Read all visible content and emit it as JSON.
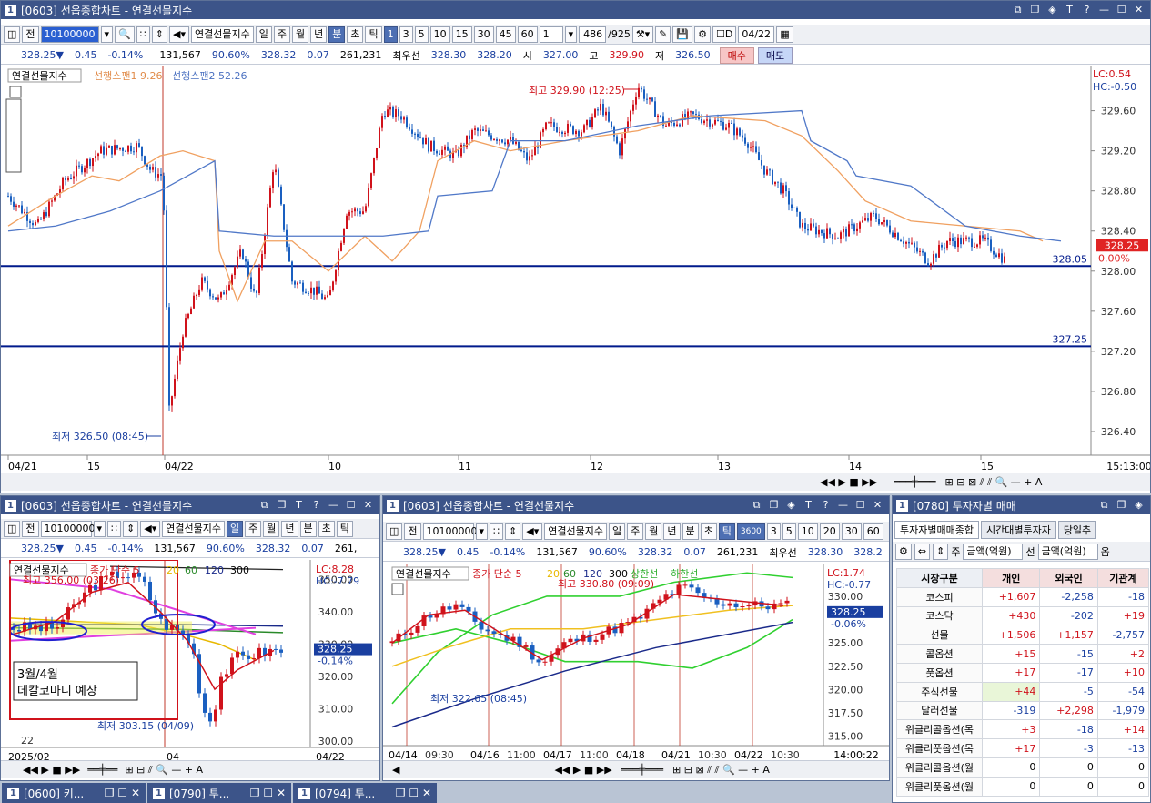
{
  "main": {
    "title": "[0603] 선옵종합차트 - 연결선물지수",
    "toolbar": {
      "code": "10100000",
      "name": "연결선물지수",
      "periods": [
        "일",
        "주",
        "월",
        "년",
        "분",
        "초",
        "틱"
      ],
      "intervals": [
        "1",
        "3",
        "5",
        "10",
        "15",
        "30",
        "45",
        "60"
      ],
      "unit": "1",
      "count": "486",
      "total": "/925",
      "date": "04/22",
      "jeon": "전"
    },
    "price": {
      "current": "328.25▼",
      "change": "0.45",
      "rate": "-0.14%",
      "volume": "131,567",
      "ratio": "90.60%",
      "avg": "328.32",
      "diff": "0.07",
      "oi": "261,231",
      "best_label": "최우선",
      "bid": "328.30",
      "ask": "328.20",
      "open_label": "시",
      "open": "327.00",
      "high_label": "고",
      "high": "329.90",
      "low_label": "저",
      "low": "326.50",
      "buy": "매수",
      "sell": "매도"
    },
    "legend": {
      "series1": "연결선물지수",
      "series2": "선행스팬1 9.26",
      "series3": "선행스팬2 52.26"
    },
    "lc": "LC:0.54",
    "hc": "HC:-0.50",
    "annot_high": "최고 329.90 (12:25)",
    "annot_low": "최저 326.50 (08:45)",
    "hline1": "328.05",
    "hline2": "327.25",
    "last_price": "328.25",
    "last_rate": "0.00%",
    "y_ticks": [
      "329.60",
      "329.20",
      "328.80",
      "328.40",
      "328.00",
      "327.60",
      "327.20",
      "326.80",
      "326.40"
    ],
    "x_ticks": [
      "04/21",
      "15",
      "04/22",
      "10",
      "11",
      "12",
      "13",
      "14",
      "15",
      "15:13:00"
    ]
  },
  "left": {
    "title": "[0603] 선옵종합차트 - 연결선물지수",
    "toolbar": {
      "code": "10100000",
      "name": "연결선물지수",
      "periods": [
        "일",
        "주",
        "월",
        "년",
        "분",
        "초",
        "틱"
      ],
      "jeon": "전"
    },
    "price": {
      "current": "328.25▼",
      "change": "0.45",
      "rate": "-0.14%",
      "volume": "131,567",
      "ratio": "90.60%",
      "avg": "328.32",
      "diff": "0.07",
      "oi": "261,"
    },
    "legend": {
      "s1": "연결선물지수",
      "s2": "종가 단순 5",
      "m20": "20",
      "m60": "60",
      "m120": "120",
      "m300": "300"
    },
    "lc": "LC:8.28",
    "hc": "HC:-7.79",
    "annot_high": "최고 356.00 (03/26)",
    "annot_low": "최저 303.15 (04/09)",
    "note1": "3월/4월",
    "note2": "데칼코마니 예상",
    "last": "328.25",
    "last_rate": "-0.14%",
    "y_ticks": [
      "350.00",
      "340.00",
      "330.00",
      "320.00",
      "310.00",
      "300.00"
    ],
    "x_ticks": [
      "2025/02",
      "04",
      "04/22"
    ],
    "x_mark": "22"
  },
  "mid": {
    "title": "[0603] 선옵종합차트 - 연결선물지수",
    "toolbar": {
      "code": "10100000",
      "name": "연결선물지수",
      "periods": [
        "일",
        "주",
        "월",
        "년",
        "분",
        "초",
        "틱"
      ],
      "intervals": [
        "3600",
        "3",
        "5",
        "10",
        "20",
        "30",
        "60"
      ],
      "jeon": "전"
    },
    "price": {
      "current": "328.25▼",
      "change": "0.45",
      "rate": "-0.14%",
      "volume": "131,567",
      "ratio": "90.60%",
      "avg": "328.32",
      "diff": "0.07",
      "oi": "261,231",
      "best_label": "최우선",
      "bid": "328.30",
      "ask": "328.2"
    },
    "legend": {
      "s1": "연결선물지수",
      "s2": "종가 단순 5",
      "m20": "20",
      "m60": "60",
      "m120": "120",
      "m300": "300",
      "up": "상한선",
      "down": "하한선"
    },
    "lc": "LC:1.74",
    "hc": "HC:-0.77",
    "annot_high": "최고 330.80 (09:09)",
    "annot_low": "최저 322.65 (08:45)",
    "last": "328.25",
    "last_rate": "-0.06%",
    "y_ticks": [
      "330.00",
      "325.00",
      "322.50",
      "320.00",
      "317.50",
      "315.00"
    ],
    "x_ticks": [
      {
        "d": "04/14",
        "t": "09:30"
      },
      {
        "d": "04/16",
        "t": "11:00"
      },
      {
        "d": "04/17",
        "t": "11:00"
      },
      {
        "d": "04/18",
        "t": ""
      },
      {
        "d": "04/21",
        "t": "10:30"
      },
      {
        "d": "04/22",
        "t": "10:30"
      }
    ],
    "x_end": "14:00:22"
  },
  "right": {
    "title": "[0780] 투자자별 매매",
    "tabs": [
      "투자자별매매종합",
      "시간대별투자자",
      "당일추"
    ],
    "filter1": "금액(억원)",
    "filter2": "금액(억원)",
    "f_label1": "주",
    "f_label2": "선",
    "f_label3": "옵",
    "headers": [
      "시장구분",
      "개인",
      "외국인",
      "기관계"
    ],
    "rows": [
      [
        "코스피",
        "+1,607",
        "-2,258",
        "-18"
      ],
      [
        "코스닥",
        "+430",
        "-202",
        "+19"
      ],
      [
        "선물",
        "+1,506",
        "+1,157",
        "-2,757"
      ],
      [
        "콜옵션",
        "+15",
        "-15",
        "+2"
      ],
      [
        "풋옵션",
        "+17",
        "-17",
        "+10"
      ],
      [
        "주식선물",
        "+44",
        "-5",
        "-54"
      ],
      [
        "달러선물",
        "-319",
        "+2,298",
        "-1,979"
      ],
      [
        "위클리콜옵션(목",
        "+3",
        "-18",
        "+14"
      ],
      [
        "위클리풋옵션(목",
        "+17",
        "-3",
        "-13"
      ],
      [
        "위클리콜옵션(월",
        "0",
        "0",
        "0"
      ],
      [
        "위클리풋옵션(월",
        "0",
        "0",
        "0"
      ]
    ]
  },
  "taskbar": [
    {
      "num": "1",
      "label": "[0600] 키..."
    },
    {
      "num": "1",
      "label": "[0790] 투..."
    },
    {
      "num": "1",
      "label": "[0794] 투..."
    }
  ],
  "colors": {
    "title": "#3c5489",
    "up": "#d0121b",
    "down": "#1a5fc0",
    "span1": "#f0a060",
    "span2": "#5078c8",
    "hline": "#001a8c"
  }
}
